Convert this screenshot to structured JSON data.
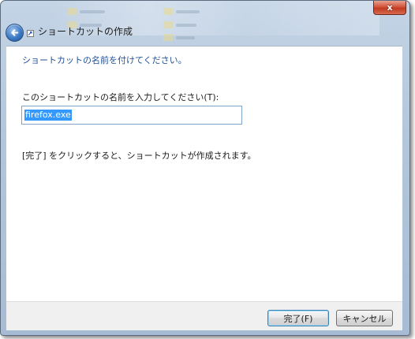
{
  "window": {
    "title": "ショートカットの作成",
    "close_symbol": "x"
  },
  "content": {
    "heading": "ショートカットの名前を付けてください。",
    "field_label": "このショートカットの名前を入力してください(T):",
    "field_value": "firefox.exe",
    "info_text": "[完了] をクリックすると、ショートカットが作成されます。"
  },
  "footer": {
    "finish_label": "完了(F)",
    "cancel_label": "キャンセル"
  },
  "colors": {
    "heading": "#1f4f96",
    "selection": "#3399ff",
    "close_button": "#c13b22"
  },
  "icons": [
    "back-arrow-icon",
    "wizard-icon",
    "close-icon"
  ]
}
